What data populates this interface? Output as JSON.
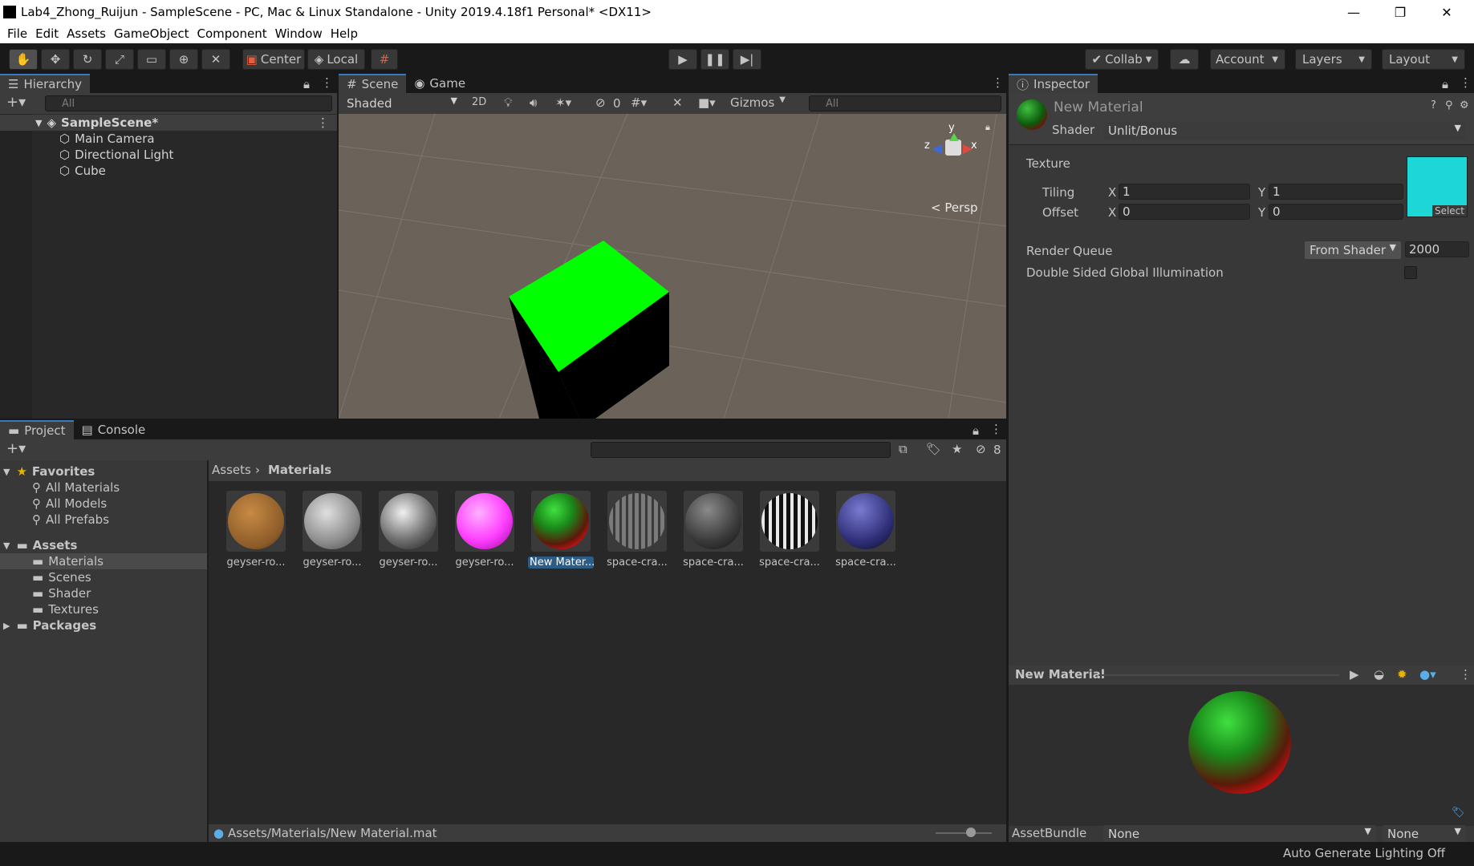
{
  "window": {
    "title": "Lab4_Zhong_Ruijun - SampleScene - PC, Mac & Linux Standalone - Unity 2019.4.18f1 Personal* <DX11>",
    "minimize": "—",
    "restore": "❐",
    "close": "✕"
  },
  "menu": [
    "File",
    "Edit",
    "Assets",
    "GameObject",
    "Component",
    "Window",
    "Help"
  ],
  "toolbar": {
    "pivot": "Center",
    "space": "Local",
    "collab": "Collab",
    "account": "Account",
    "layers": "Layers",
    "layout": "Layout"
  },
  "hierarchy": {
    "tab": "Hierarchy",
    "search_placeholder": "All",
    "scene": "SampleScene*",
    "objects": [
      "Main Camera",
      "Directional Light",
      "Cube"
    ]
  },
  "scene_view": {
    "tab_scene": "Scene",
    "tab_game": "Game",
    "shading": "Shaded",
    "mode_2d": "2D",
    "hidden_count": "0",
    "gizmos": "Gizmos",
    "search_placeholder": "All",
    "persp": "< Persp",
    "axis_y": "y",
    "axis_x": "x",
    "axis_z": "z"
  },
  "project": {
    "tab_project": "Project",
    "tab_console": "Console",
    "hidden_count": "8",
    "favorites_label": "Favorites",
    "favorites": [
      "All Materials",
      "All Models",
      "All Prefabs"
    ],
    "assets_label": "Assets",
    "folders": [
      "Materials",
      "Scenes",
      "Shader",
      "Textures"
    ],
    "packages_label": "Packages",
    "breadcrumb_root": "Assets",
    "breadcrumb_current": "Materials",
    "items": [
      "geyser-ro...",
      "geyser-ro...",
      "geyser-ro...",
      "geyser-ro...",
      "New Mater...",
      "space-cra...",
      "space-cra...",
      "space-cra...",
      "space-cra..."
    ],
    "selected_path": "Assets/Materials/New Material.mat"
  },
  "inspector": {
    "tab": "Inspector",
    "material_name": "New Material",
    "shader_label": "Shader",
    "shader_value": "Unlit/Bonus",
    "texture_label": "Texture",
    "tiling_label": "Tiling",
    "offset_label": "Offset",
    "x_label": "X",
    "y_label": "Y",
    "tiling_x": "1",
    "tiling_y": "1",
    "offset_x": "0",
    "offset_y": "0",
    "select_label": "Select",
    "render_queue_label": "Render Queue",
    "render_queue_mode": "From Shader",
    "render_queue_value": "2000",
    "double_sided_label": "Double Sided Global Illumination",
    "preview_title": "New Material",
    "assetbundle_label": "AssetBundle",
    "assetbundle_value": "None",
    "assetbundle_variant": "None"
  },
  "status": {
    "lighting": "Auto Generate Lighting Off"
  },
  "colors": {
    "accent": "#3a79bb",
    "cube_top": "#00ff00",
    "texture_swatch": "#1dd6d6",
    "selection": "#2c5d87"
  }
}
